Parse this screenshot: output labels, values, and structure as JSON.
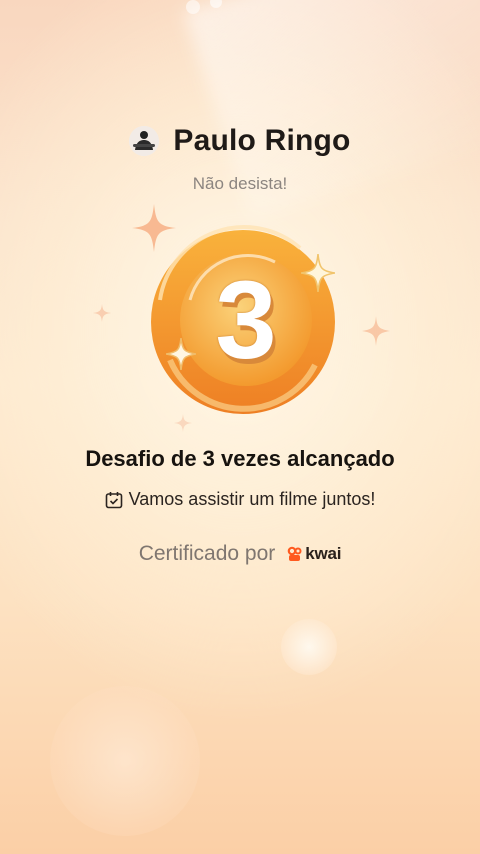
{
  "profile": {
    "user_name": "Paulo Ringo",
    "avatar_icon": "avatar-icon"
  },
  "subtitle": "Não desista!",
  "medal": {
    "number": "3",
    "colors": {
      "outer": "#f2962e",
      "inner": "#f7b23f",
      "number": "#ffffff",
      "sparkle": "#f6b27e"
    }
  },
  "achievement": {
    "title": "Desafio de 3 vezes alcançado",
    "task_icon": "calendar-check-icon",
    "task_text": "Vamos assistir um filme juntos!"
  },
  "certification": {
    "prefix": "Certificado por",
    "brand_icon": "kwai-logo-icon",
    "brand_name": "kwai",
    "brand_color": "#ff5a1f"
  }
}
